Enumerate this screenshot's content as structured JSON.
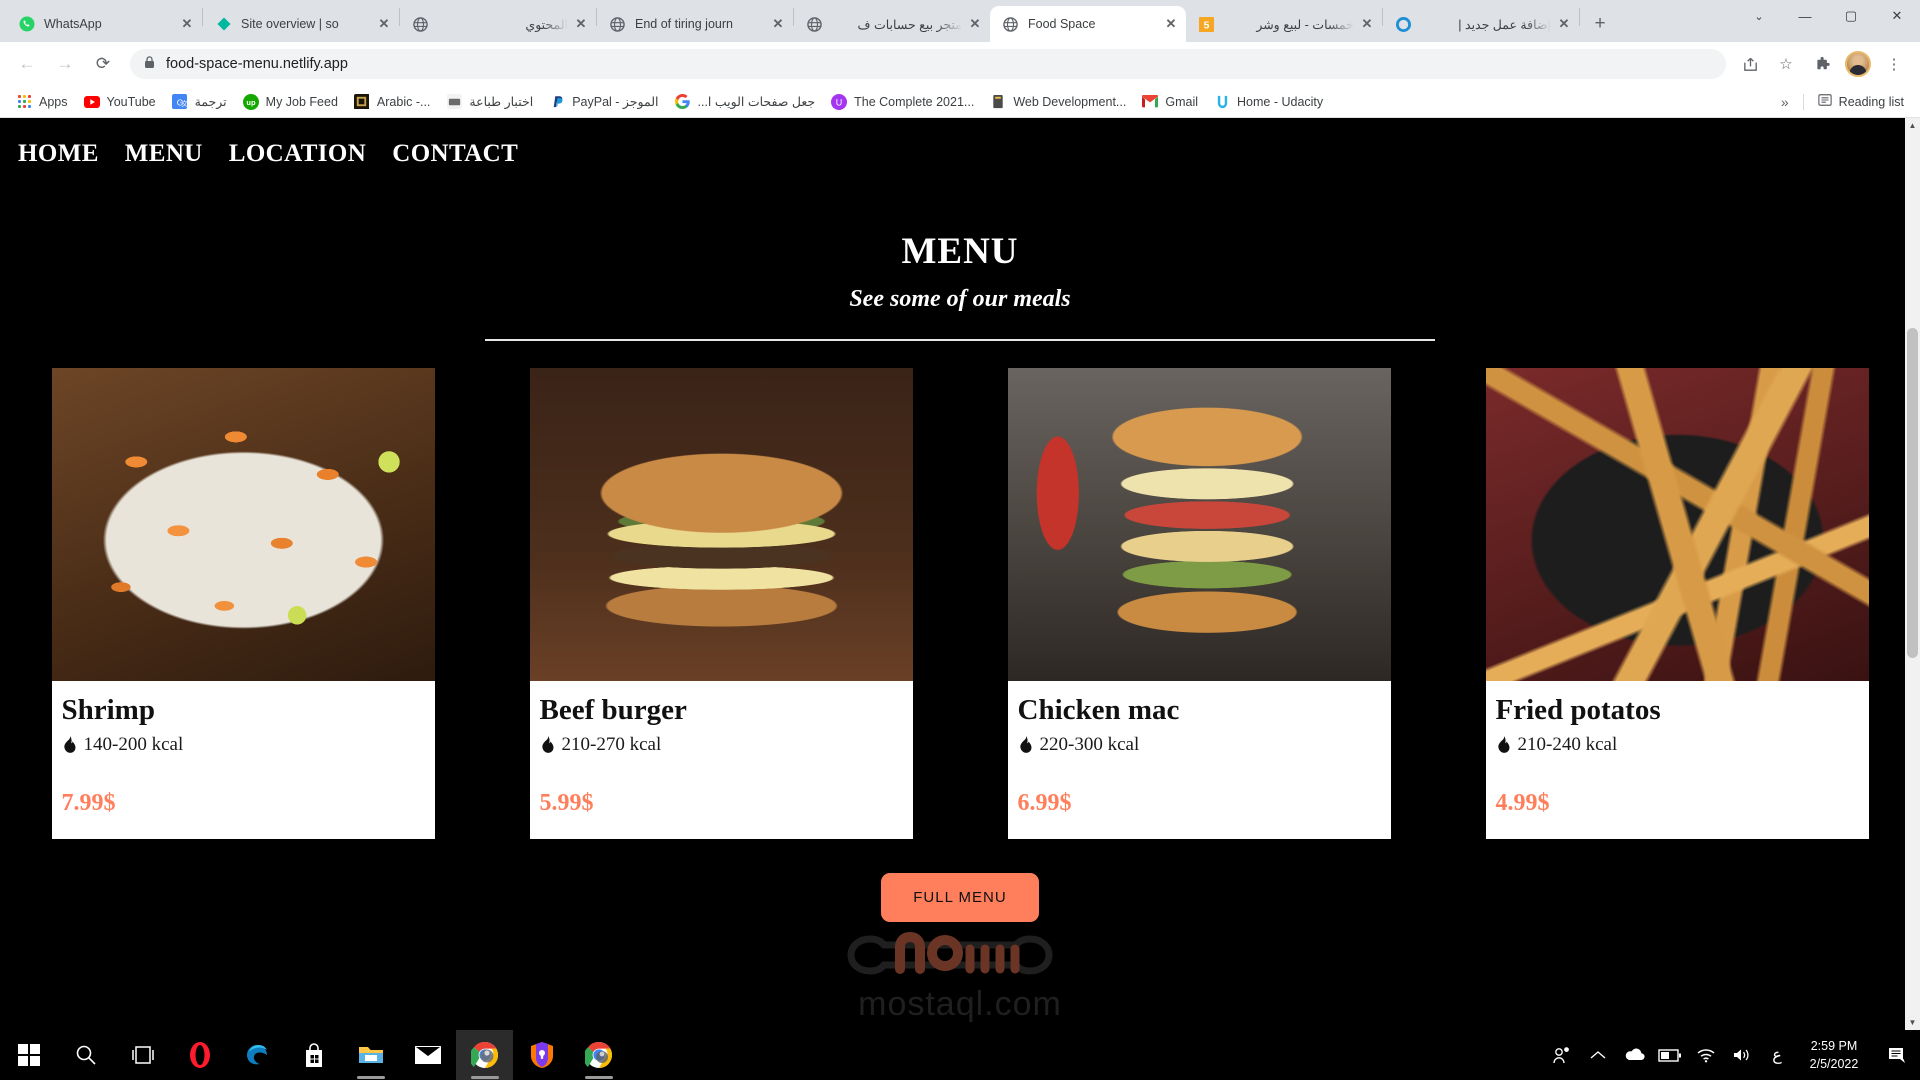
{
  "browser": {
    "tabs": [
      {
        "title": "WhatsApp",
        "icon": "whatsapp-icon",
        "active": false,
        "rtl": false
      },
      {
        "title": "Site overview | so",
        "icon": "semrush-icon",
        "active": false,
        "rtl": false
      },
      {
        "title": "المحتوي",
        "icon": "globe-icon",
        "active": false,
        "rtl": true
      },
      {
        "title": "End of tiring journ",
        "icon": "globe-icon",
        "active": false,
        "rtl": false
      },
      {
        "title": "متجر بيع حسابات ف",
        "icon": "globe-icon",
        "active": false,
        "rtl": true
      },
      {
        "title": "Food Space",
        "icon": "globe-icon",
        "active": true,
        "rtl": false
      },
      {
        "title": "خمسات - لبيع وشر",
        "icon": "khamsat-icon",
        "active": false,
        "rtl": true
      },
      {
        "title": "إضافة عمل جديد |",
        "icon": "mostaql-icon",
        "active": false,
        "rtl": true
      }
    ],
    "new_tab_label": "+",
    "window_controls": {
      "chevron": "⌄",
      "minimize": "—",
      "maximize": "▢",
      "close": "✕"
    },
    "toolbar": {
      "back": "←",
      "forward": "→",
      "reload": "⟳",
      "lock_icon": "🔒",
      "url": "food-space-menu.netlify.app",
      "share": "share-icon",
      "bookmark_star": "☆",
      "extensions": "puzzle-icon",
      "menu": "⋮"
    },
    "bookmarks": [
      {
        "label": "Apps",
        "icon": "apps-grid-icon",
        "rtl": false
      },
      {
        "label": "YouTube",
        "icon": "youtube-icon",
        "rtl": false
      },
      {
        "label": "ترجمة",
        "icon": "google-translate-icon",
        "rtl": true
      },
      {
        "label": "My Job Feed",
        "icon": "upwork-icon",
        "rtl": false
      },
      {
        "label": "Arabic -...",
        "icon": "book-icon",
        "rtl": false
      },
      {
        "label": "اختبار طباعة",
        "icon": "typing-icon",
        "rtl": true
      },
      {
        "label": "PayPal - الموجز",
        "icon": "paypal-icon",
        "rtl": false
      },
      {
        "label": "جعل صفحات الويب ا...",
        "icon": "google-icon",
        "rtl": true
      },
      {
        "label": "The Complete 2021...",
        "icon": "udemy-icon",
        "rtl": false
      },
      {
        "label": "Web Development...",
        "icon": "doc-icon",
        "rtl": false
      },
      {
        "label": "Gmail",
        "icon": "gmail-icon",
        "rtl": false
      },
      {
        "label": "Home - Udacity",
        "icon": "udacity-icon",
        "rtl": false
      }
    ],
    "bookmarks_overflow": "»",
    "reading_list": {
      "label": "Reading list",
      "icon": "reading-list-icon"
    }
  },
  "site": {
    "nav": [
      {
        "label": "HOME"
      },
      {
        "label": "MENU"
      },
      {
        "label": "LOCATION"
      },
      {
        "label": "CONTACT"
      }
    ],
    "section": {
      "title": "MENU",
      "subtitle": "See some of our meals"
    },
    "cards": [
      {
        "name": "Shrimp",
        "kcal": "140-200 kcal",
        "price": "7.99$",
        "photo": "shrimp-photo",
        "kcal_icon": "flame-icon"
      },
      {
        "name": "Beef burger",
        "kcal": "210-270 kcal",
        "price": "5.99$",
        "photo": "burger-photo",
        "kcal_icon": "flame-icon"
      },
      {
        "name": "Chicken mac",
        "kcal": "220-300 kcal",
        "price": "6.99$",
        "photo": "chicken-photo",
        "kcal_icon": "flame-icon"
      },
      {
        "name": "Fried potatos",
        "kcal": "210-240 kcal",
        "price": "4.99$",
        "photo": "potato-photo",
        "kcal_icon": "flame-icon"
      }
    ],
    "full_menu_button": "FULL MENU",
    "accent_color": "#ff7f5c",
    "background_color": "#000000",
    "watermark": "mostaql.com"
  },
  "taskbar": {
    "items": [
      {
        "name": "start-button",
        "icon": "windows-icon"
      },
      {
        "name": "search-button",
        "icon": "search-icon"
      },
      {
        "name": "task-view-button",
        "icon": "task-view-icon"
      },
      {
        "name": "opera-button",
        "icon": "opera-icon"
      },
      {
        "name": "edge-button",
        "icon": "edge-icon"
      },
      {
        "name": "microsoft-store-button",
        "icon": "store-icon"
      },
      {
        "name": "file-explorer-button",
        "icon": "folder-icon"
      },
      {
        "name": "mail-button",
        "icon": "mail-icon"
      },
      {
        "name": "chrome-button",
        "icon": "chrome-icon"
      },
      {
        "name": "avast-button",
        "icon": "avast-icon"
      },
      {
        "name": "chrome-second-button",
        "icon": "chrome-icon"
      }
    ],
    "tray": [
      {
        "name": "people-icon",
        "glyph": "people"
      },
      {
        "name": "show-hidden-icons",
        "glyph": "chevron-up"
      },
      {
        "name": "onedrive-icon",
        "glyph": "cloud"
      },
      {
        "name": "battery-icon",
        "glyph": "battery"
      },
      {
        "name": "wifi-icon",
        "glyph": "wifi"
      },
      {
        "name": "volume-icon",
        "glyph": "volume"
      }
    ],
    "language": "ع",
    "time": "2:59 PM",
    "date": "2/5/2022",
    "notification_icon": "notification-icon"
  }
}
